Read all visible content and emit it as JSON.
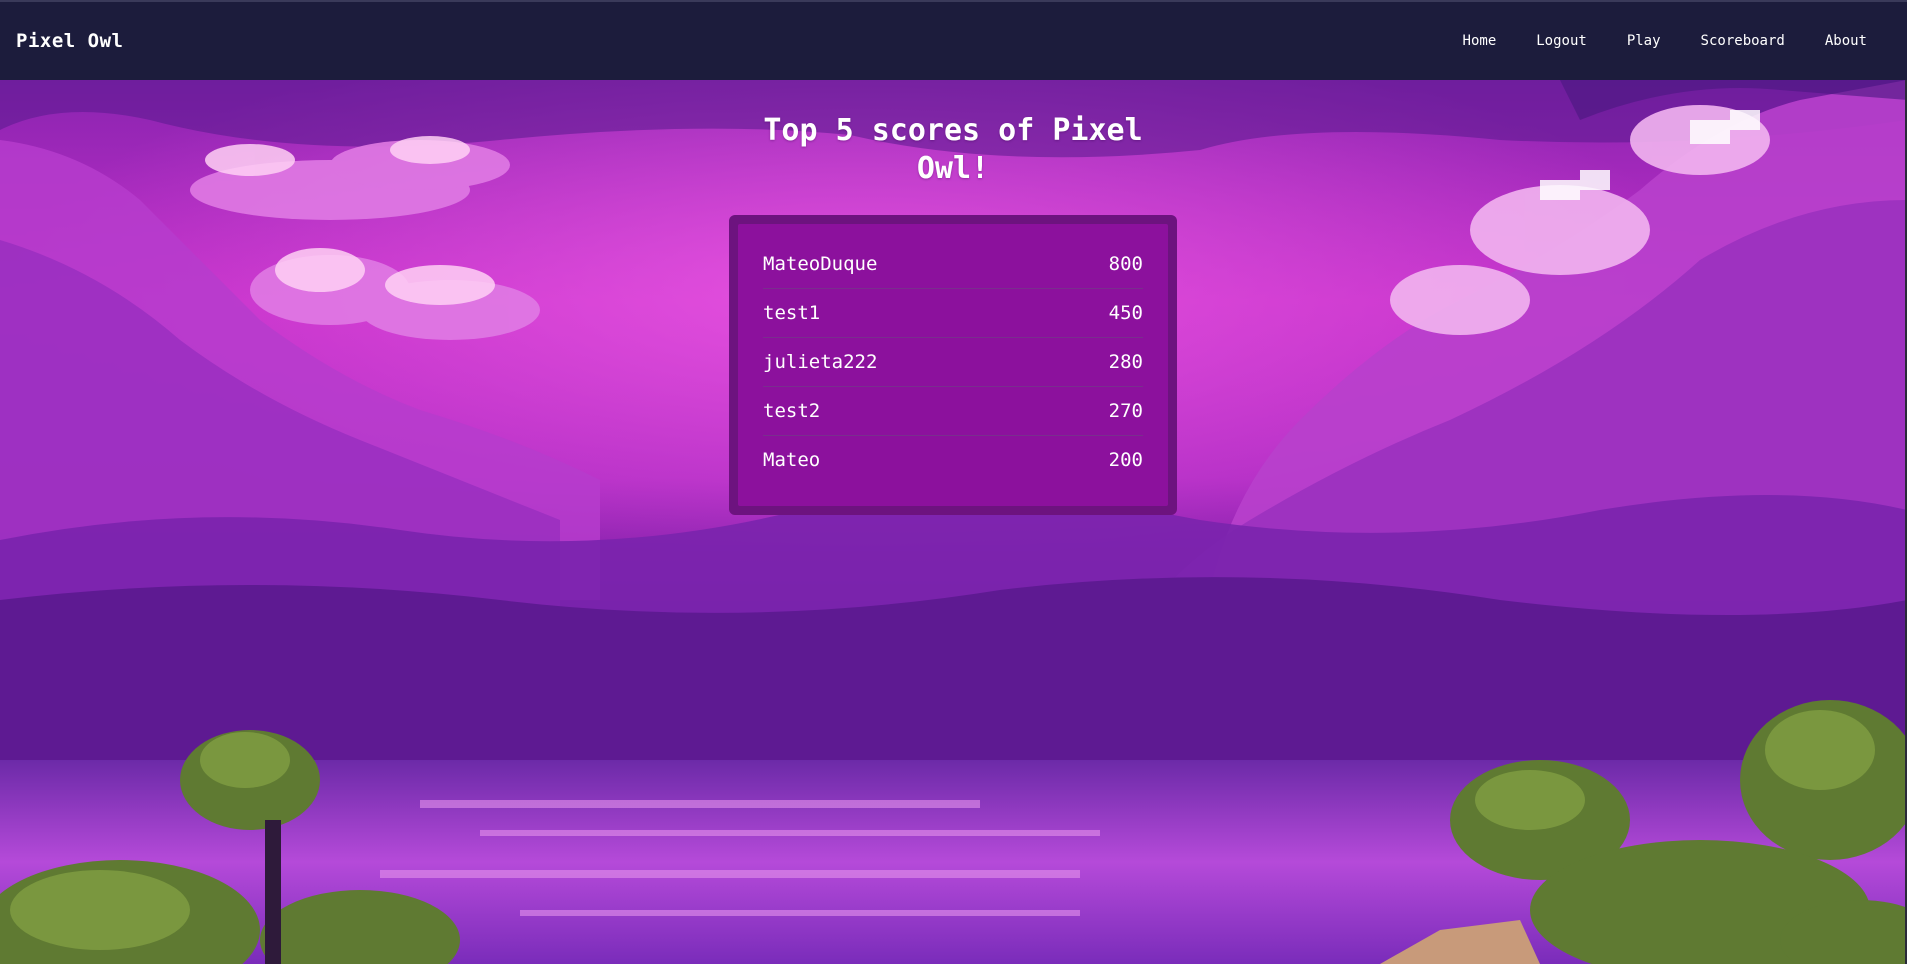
{
  "navbar": {
    "brand": "Pixel Owl",
    "links": [
      "Home",
      "Logout",
      "Play",
      "Scoreboard",
      "About"
    ]
  },
  "page": {
    "title": "Top 5 scores of Pixel Owl!"
  },
  "scores": [
    {
      "name": "MateoDuque",
      "score": "800"
    },
    {
      "name": "test1",
      "score": "450"
    },
    {
      "name": "julieta222",
      "score": "280"
    },
    {
      "name": "test2",
      "score": "270"
    },
    {
      "name": "Mateo",
      "score": "200"
    }
  ],
  "colors": {
    "navbar": "#1c1c3c",
    "card_border": "#6d137f",
    "card_fill": "#8c119d",
    "sky_top": "#7a1fa6",
    "sky_mid": "#d43ad2",
    "water": "#9a35c8",
    "trees": "#5f7a32"
  },
  "background": {
    "description_icon": "pixel-art-purple-sky-clouds-lake-trees"
  }
}
